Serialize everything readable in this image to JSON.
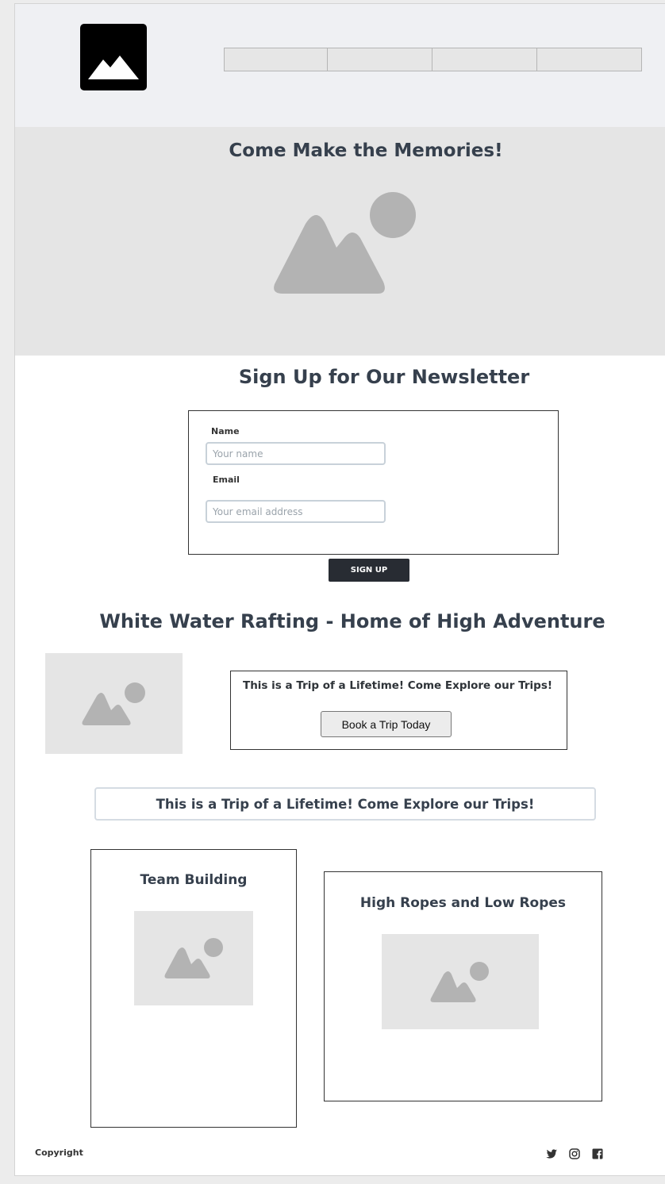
{
  "header": {
    "logo_icon": "image-icon",
    "nav_items": [
      "",
      "",
      "",
      ""
    ]
  },
  "hero": {
    "title": "Come Make the Memories!",
    "image_icon": "image-placeholder-icon"
  },
  "newsletter": {
    "title": "Sign Up for Our Newsletter",
    "name_label": "Name",
    "name_placeholder": "Your name",
    "email_label": "Email",
    "email_placeholder": "Your email address",
    "submit_label": "SIGN UP"
  },
  "rafting": {
    "title": "White Water Rafting - Home of High Adventure",
    "trip_text": "This is a Trip of a Lifetime!  Come Explore our Trips!",
    "book_button_label": "Book a Trip Today"
  },
  "banner": {
    "text": "This is a Trip of a Lifetime!  Come Explore our Trips!"
  },
  "cards": [
    {
      "title": "Team Building"
    },
    {
      "title": "High Ropes and Low Ropes"
    }
  ],
  "footer": {
    "copyright": "Copyright",
    "social_icons": [
      "twitter-icon",
      "instagram-icon",
      "facebook-icon"
    ]
  },
  "colors": {
    "heading": "#36404d",
    "button_dark": "#282c33",
    "placeholder_gray": "#b3b3b3",
    "hero_background": "#e5e5e5",
    "header_background": "#eff0f3"
  }
}
